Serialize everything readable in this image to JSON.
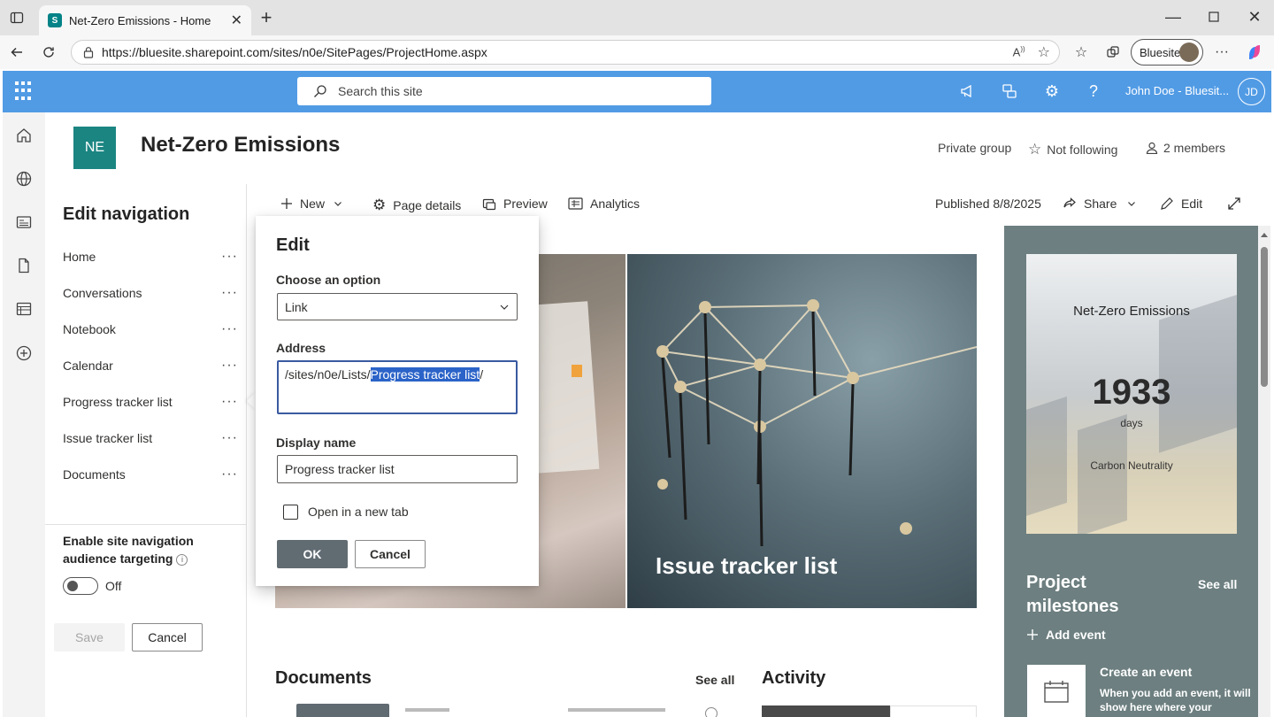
{
  "browser": {
    "tab_title": "Net-Zero Emissions - Home",
    "url": "https://bluesite.sharepoint.com/sites/n0e/SitePages/ProjectHome.aspx",
    "profile_name": "Bluesite"
  },
  "suite": {
    "search_placeholder": "Search this site",
    "user_name": "John Doe - Bluesit...",
    "user_initials": "JD"
  },
  "site": {
    "logo_initials": "NE",
    "title": "Net-Zero Emissions",
    "privacy": "Private group",
    "follow_label": "Not following",
    "members_label": "2 members"
  },
  "nav_panel": {
    "heading": "Edit navigation",
    "items": [
      {
        "label": "Home"
      },
      {
        "label": "Conversations"
      },
      {
        "label": "Notebook"
      },
      {
        "label": "Calendar"
      },
      {
        "label": "Progress tracker list"
      },
      {
        "label": "Issue tracker list"
      },
      {
        "label": "Documents"
      }
    ],
    "more_glyph": "···",
    "targeting_label": "Enable site navigation audience targeting",
    "toggle_state": "Off",
    "save_label": "Save",
    "cancel_label": "Cancel"
  },
  "command_bar": {
    "new_label": "New",
    "page_details_label": "Page details",
    "preview_label": "Preview",
    "analytics_label": "Analytics",
    "published_label": "Published 8/8/2025",
    "share_label": "Share",
    "edit_label": "Edit"
  },
  "edit_callout": {
    "title": "Edit",
    "option_label": "Choose an option",
    "option_value": "Link",
    "address_label": "Address",
    "address_prefix": "/sites/n0e/Lists/",
    "address_selected": "Progress tracker list",
    "address_suffix": "/",
    "display_name_label": "Display name",
    "display_name_value": "Progress tracker list",
    "new_tab_label": "Open in a new tab",
    "ok_label": "OK",
    "cancel_label": "Cancel"
  },
  "hero": {
    "right_caption": "Issue tracker list"
  },
  "countdown": {
    "title": "Net-Zero Emissions",
    "number": "1933",
    "unit": "days",
    "subtitle": "Carbon Neutrality"
  },
  "milestones": {
    "title": "Project milestones",
    "see_all": "See all",
    "add_event": "Add event",
    "create_title": "Create an event",
    "create_desc": "When you add an event, it will show here where your"
  },
  "sections": {
    "documents_title": "Documents",
    "documents_see_all": "See all",
    "activity_title": "Activity"
  },
  "colors": {
    "suite_bar": "#519be5",
    "site_logo": "#1b8582",
    "right_column": "#6d7f80",
    "ok_button": "#616b72",
    "selection": "#2b63c8"
  }
}
